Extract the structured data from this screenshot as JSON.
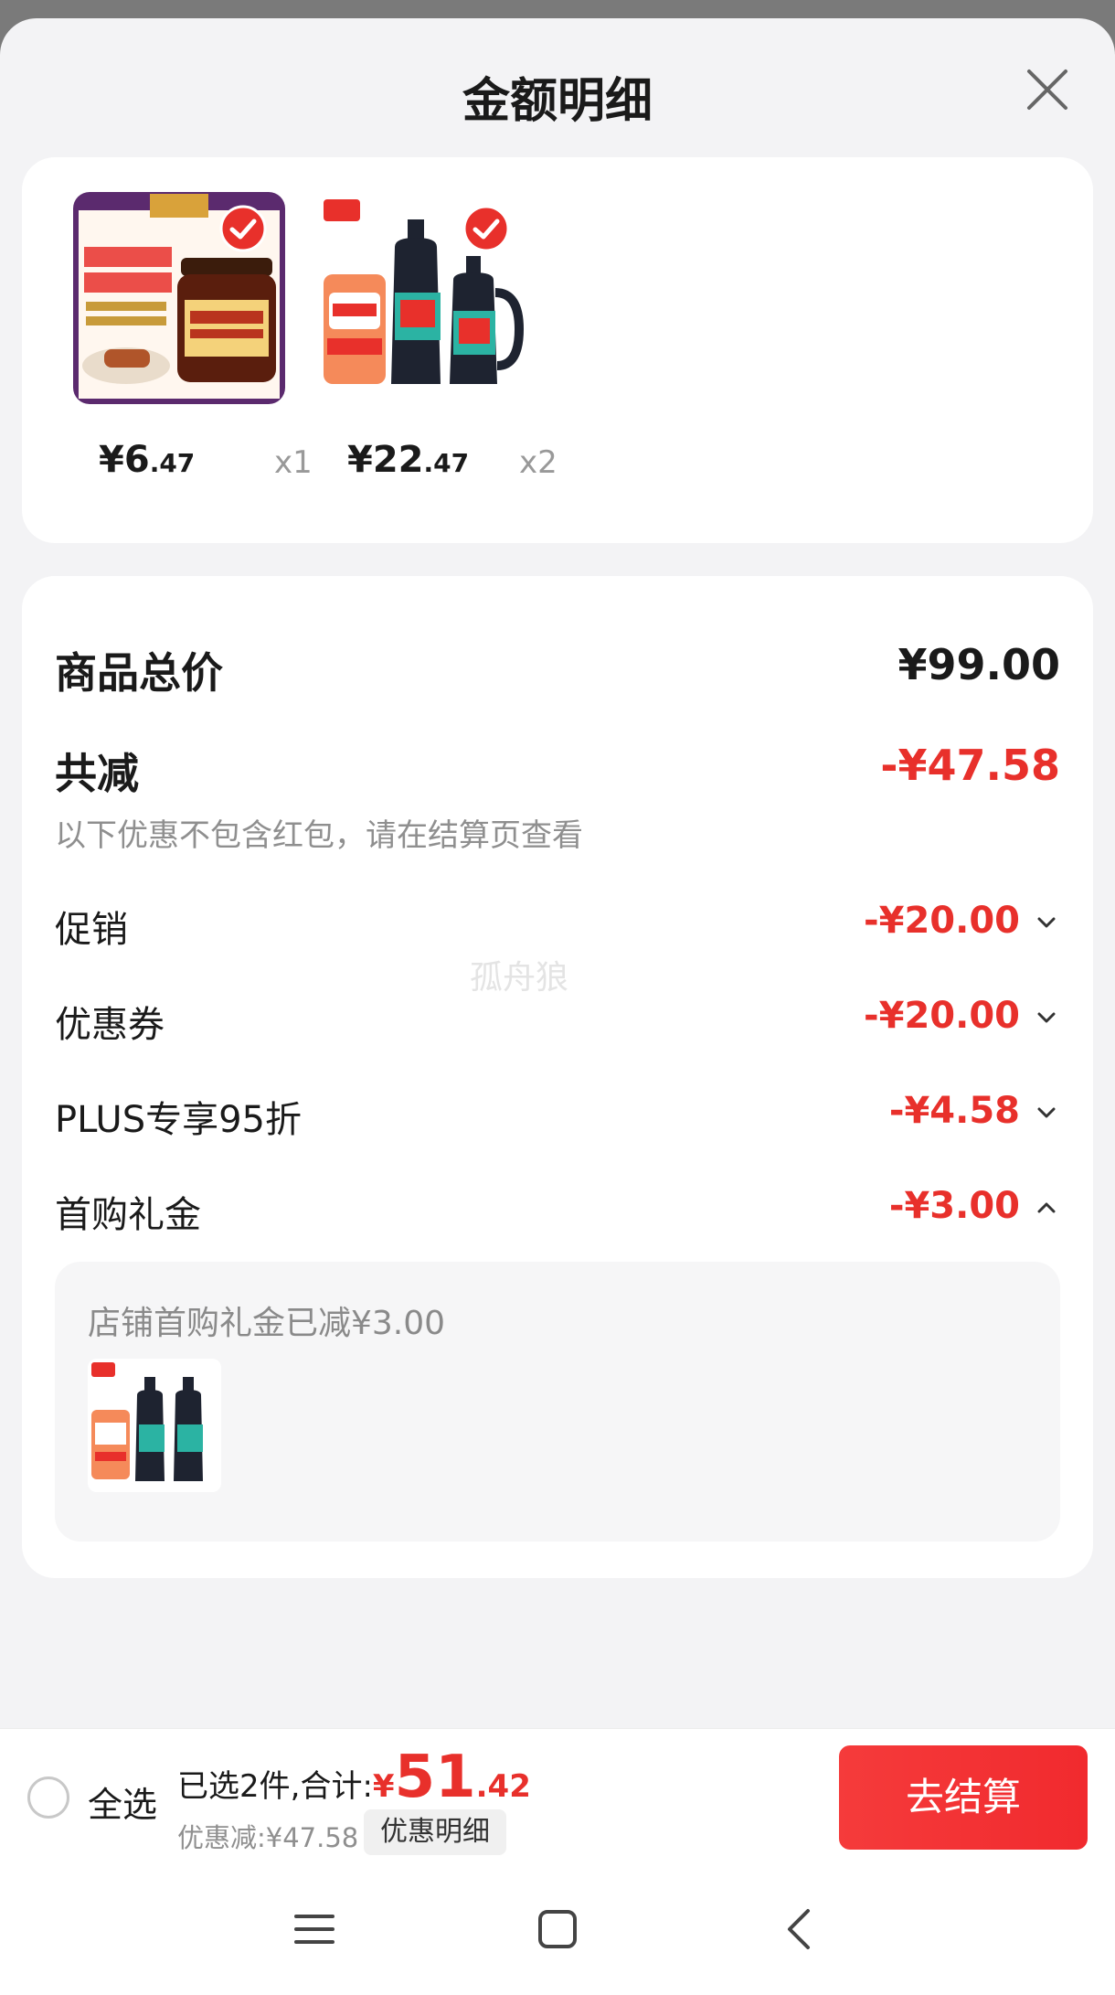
{
  "sheet": {
    "title": "金额明细"
  },
  "products": [
    {
      "image_icon": "char-siu-sauce-jar",
      "selected": true,
      "price_symbol": "¥",
      "price_int": "6",
      "price_dec": ".47",
      "quantity": "x1"
    },
    {
      "image_icon": "soy-sauce-bottles",
      "selected": true,
      "price_symbol": "¥",
      "price_int": "22",
      "price_dec": ".47",
      "quantity": "x2"
    }
  ],
  "summary": {
    "total_label": "商品总价",
    "total_value": "¥99.00",
    "reduce_label": "共减",
    "reduce_value": "-¥47.58",
    "note": "以下优惠不包含红包，请在结算页查看"
  },
  "discounts": [
    {
      "label": "促销",
      "value": "-¥20.00",
      "state": "collapsed"
    },
    {
      "label": "优惠券",
      "value": "-¥20.00",
      "state": "collapsed"
    },
    {
      "label": "PLUS专享95折",
      "value": "-¥4.58",
      "state": "collapsed"
    },
    {
      "label": "首购礼金",
      "value": "-¥3.00",
      "state": "expanded"
    }
  ],
  "first_purchase_detail": {
    "text": "店铺首购礼金已减¥3.00"
  },
  "watermark": "孤舟狼",
  "bottom_bar": {
    "select_all": "全选",
    "selected_count": "已选2件,合计:",
    "currency": "¥",
    "total_int": "51",
    "total_dec": ".42",
    "saved": "优惠减:¥47.58",
    "detail_chip": "优惠明细",
    "checkout": "去结算"
  },
  "colors": {
    "accent_red": "#e8302b",
    "checkout_red": "#f53b3b",
    "sheet_bg": "#f3f3f5"
  }
}
